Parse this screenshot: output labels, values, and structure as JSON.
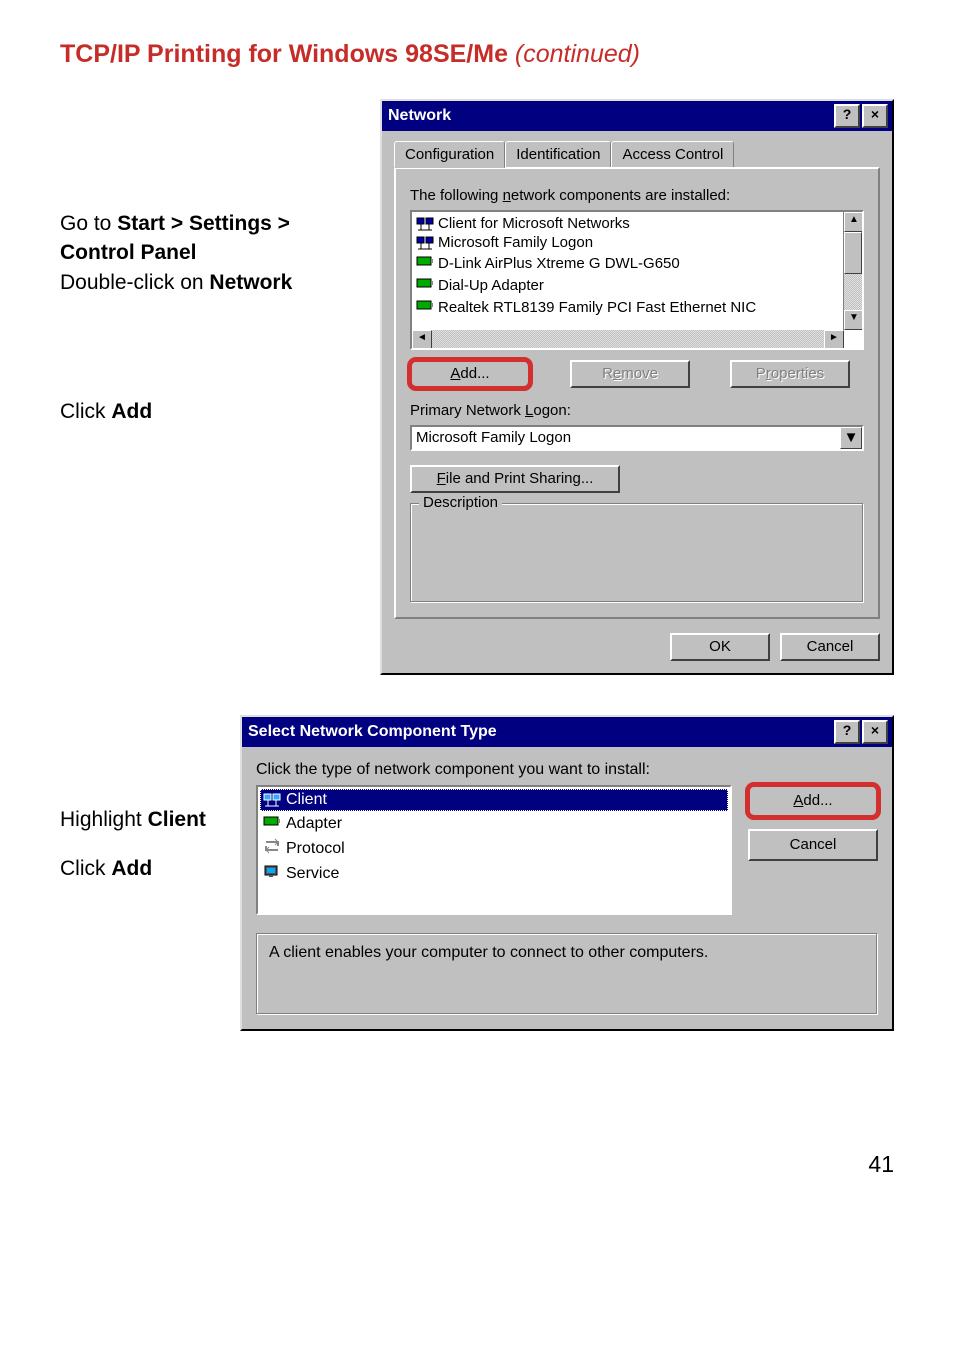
{
  "page": {
    "title_main": "TCP/IP Printing for Windows 98SE/Me ",
    "title_cont": "(continued)",
    "page_number": "41"
  },
  "instructions_top": {
    "line1_pre": "Go to ",
    "line1_bold": "Start > Settings > Control Panel",
    "line2_pre": "Double-click on ",
    "line2_bold": "Network",
    "click_add_pre": "Click ",
    "click_add_bold": "Add"
  },
  "instructions_bottom": {
    "line1_pre": "Highlight ",
    "line1_bold": "Client",
    "line2_pre": "Click ",
    "line2_bold": "Add"
  },
  "dialog1": {
    "title": "Network",
    "tabs": {
      "configuration": "Configuration",
      "identification": "Identification",
      "access": "Access Control"
    },
    "list_label_pre": "The following ",
    "list_label_ul": "n",
    "list_label_post": "etwork components are installed:",
    "items": [
      {
        "icon": "client",
        "text": "Client for Microsoft Networks"
      },
      {
        "icon": "client",
        "text": "Microsoft Family Logon"
      },
      {
        "icon": "adapter",
        "text": "D-Link AirPlus Xtreme G DWL-G650"
      },
      {
        "icon": "adapter",
        "text": "Dial-Up Adapter"
      },
      {
        "icon": "adapter",
        "text": "Realtek RTL8139 Family PCI Fast Ethernet NIC"
      }
    ],
    "buttons": {
      "add_ul": "A",
      "add_post": "dd...",
      "remove_pre": "R",
      "remove_ul": "e",
      "remove_post": "move",
      "properties_pre": "P",
      "properties_ul": "r",
      "properties_post": "operties"
    },
    "logon_label_pre": "Primary Network ",
    "logon_label_ul": "L",
    "logon_label_post": "ogon:",
    "logon_value": "Microsoft Family Logon",
    "file_print_ul": "F",
    "file_print_post": "ile and Print Sharing...",
    "description_legend": "Description",
    "ok": "OK",
    "cancel": "Cancel"
  },
  "dialog2": {
    "title": "Select Network Component Type",
    "prompt": "Click the type of network component you want to install:",
    "items": {
      "client": "Client",
      "adapter": "Adapter",
      "protocol": "Protocol",
      "service": "Service"
    },
    "add_ul": "A",
    "add_post": "dd...",
    "cancel": "Cancel",
    "desc": "A client enables your computer to connect to other computers."
  }
}
